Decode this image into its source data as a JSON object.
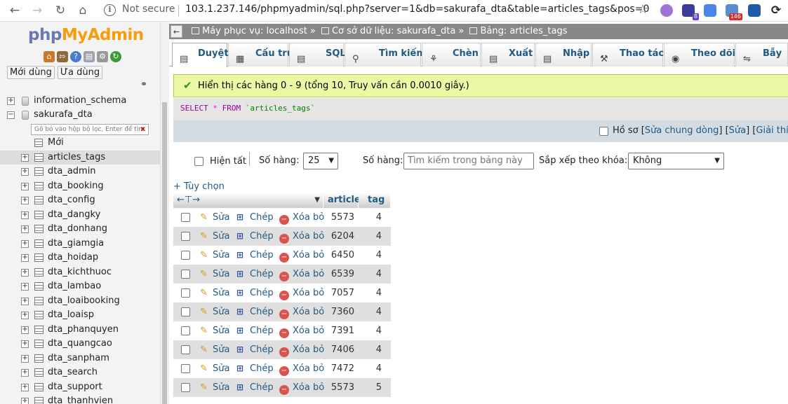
{
  "browser": {
    "security_label": "Not secure",
    "url": "103.1.237.146/phpmyadmin/sql.php?server=1&db=sakurafa_dta&table=articles_tags&pos=0",
    "ext_badge_1": "8",
    "ext_badge_2": "146"
  },
  "sidebar": {
    "logo_php": "php",
    "logo_myadmin": "MyAdmin",
    "recent_label": "Mới dùng",
    "favorite_label": "Ưa dùng",
    "databases": [
      {
        "name": "information_schema"
      },
      {
        "name": "sakurafa_dta"
      }
    ],
    "filter_placeholder": "Gõ bỏ vào hộp bộ lọc, Enter để tìm",
    "new_label": "Mới",
    "tables": [
      "articles_tags",
      "dta_admin",
      "dta_booking",
      "dta_config",
      "dta_dangky",
      "dta_donhang",
      "dta_giamgia",
      "dta_hoidap",
      "dta_kichthuoc",
      "dta_lambao",
      "dta_loaibooking",
      "dta_loaisp",
      "dta_phanquyen",
      "dta_quangcao",
      "dta_sanpham",
      "dta_search",
      "dta_support",
      "dta_thanhvien"
    ]
  },
  "breadcrumb": {
    "server": "Máy phục vụ: localhost",
    "database": "Cơ sở dữ liệu: sakurafa_dta",
    "table": "Bảng: articles_tags"
  },
  "tabs": [
    {
      "label": "Duyệt",
      "icon": "browse-icon"
    },
    {
      "label": "Cấu trúc",
      "icon": "structure-icon"
    },
    {
      "label": "SQL",
      "icon": "sql-icon"
    },
    {
      "label": "Tìm kiếm",
      "icon": "search-icon"
    },
    {
      "label": "Chèn",
      "icon": "insert-icon"
    },
    {
      "label": "Xuất",
      "icon": "export-icon"
    },
    {
      "label": "Nhập",
      "icon": "import-icon"
    },
    {
      "label": "Thao tác",
      "icon": "operations-icon"
    },
    {
      "label": "Theo dõi",
      "icon": "tracking-icon"
    },
    {
      "label": "Bẫy",
      "icon": "triggers-icon"
    }
  ],
  "message": "Hiển thị các hàng 0 - 9 (tổng 10, Truy vấn cần 0.0010 giây.)",
  "query": {
    "select": "SELECT",
    "star": "*",
    "from": "FROM",
    "table": "`articles_tags`"
  },
  "query_actions": {
    "profiling": "Hồ sơ",
    "edit_inline": "Sửa chung dòng",
    "edit": "Sửa",
    "explain": "Giải thích"
  },
  "nav": {
    "show_all": "Hiện tất",
    "rows_label": "Số hàng:",
    "rows_value": "25",
    "filter_label": "Số hàng:",
    "filter_placeholder": "Tìm kiếm trong bảng này",
    "sort_label": "Sắp xếp theo khóa:",
    "sort_value": "Không"
  },
  "options_link": "+ Tùy chọn",
  "table": {
    "columns": [
      "article",
      "tag"
    ],
    "action_labels": {
      "edit": "Sửa",
      "copy": "Chép",
      "delete": "Xóa bỏ"
    },
    "rows": [
      {
        "article": "5573",
        "tag": "4"
      },
      {
        "article": "6204",
        "tag": "4"
      },
      {
        "article": "6450",
        "tag": "4"
      },
      {
        "article": "6539",
        "tag": "4"
      },
      {
        "article": "7057",
        "tag": "4"
      },
      {
        "article": "7360",
        "tag": "4"
      },
      {
        "article": "7391",
        "tag": "4"
      },
      {
        "article": "7406",
        "tag": "4"
      },
      {
        "article": "7472",
        "tag": "4"
      },
      {
        "article": "5573",
        "tag": "5"
      }
    ]
  }
}
